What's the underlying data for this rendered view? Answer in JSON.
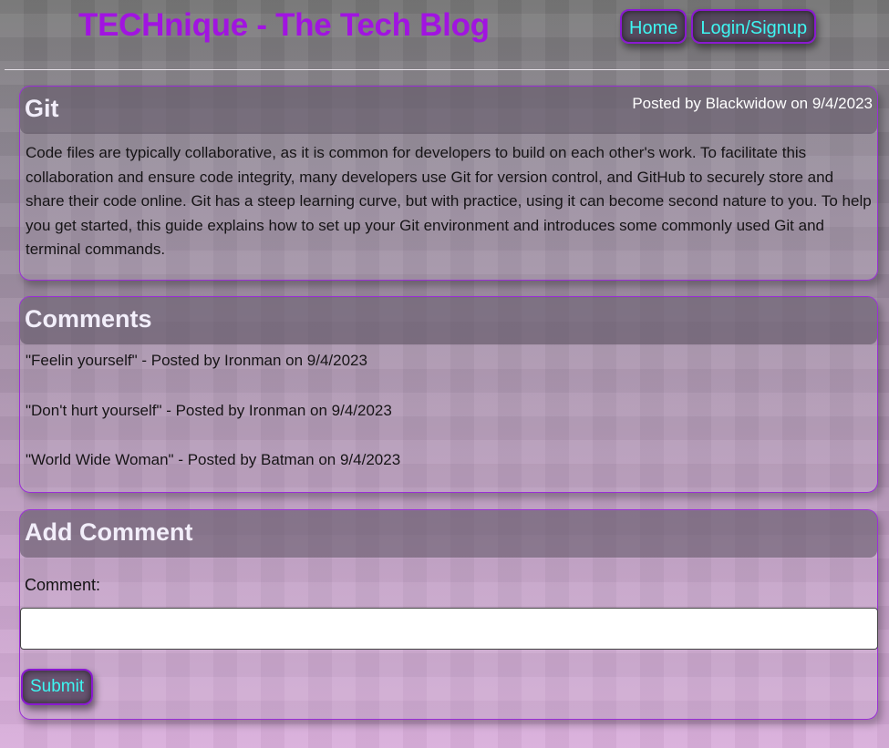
{
  "header": {
    "site_title": "TECHnique - The Tech Blog",
    "nav": {
      "home_label": "Home",
      "login_label": "Login/Signup"
    }
  },
  "post": {
    "title": "Git",
    "meta": "Posted by Blackwidow on 9/4/2023",
    "body": "Code files are typically collaborative, as it is common for developers to build on each other's work. To facilitate this collaboration and ensure code integrity, many developers use Git for version control, and GitHub to securely store and share their code online. Git has a steep learning curve, but with practice, using it can become second nature to you. To help you get started, this guide explains how to set up your Git environment and introduces some commonly used Git and terminal commands."
  },
  "comments": {
    "heading": "Comments",
    "items": [
      {
        "text": "\"Feelin yourself\" - Posted by Ironman on 9/4/2023"
      },
      {
        "text": "\"Don't hurt yourself\" - Posted by Ironman on 9/4/2023"
      },
      {
        "text": "\"World Wide Woman\" - Posted by Batman on 9/4/2023"
      }
    ]
  },
  "add_comment": {
    "heading": "Add Comment",
    "label": "Comment:",
    "input_value": "",
    "submit_label": "Submit"
  },
  "colors": {
    "title_purple": "#a114e0",
    "button_text_cyan": "#3ef6f2",
    "border_purple": "#9a2fd6"
  }
}
